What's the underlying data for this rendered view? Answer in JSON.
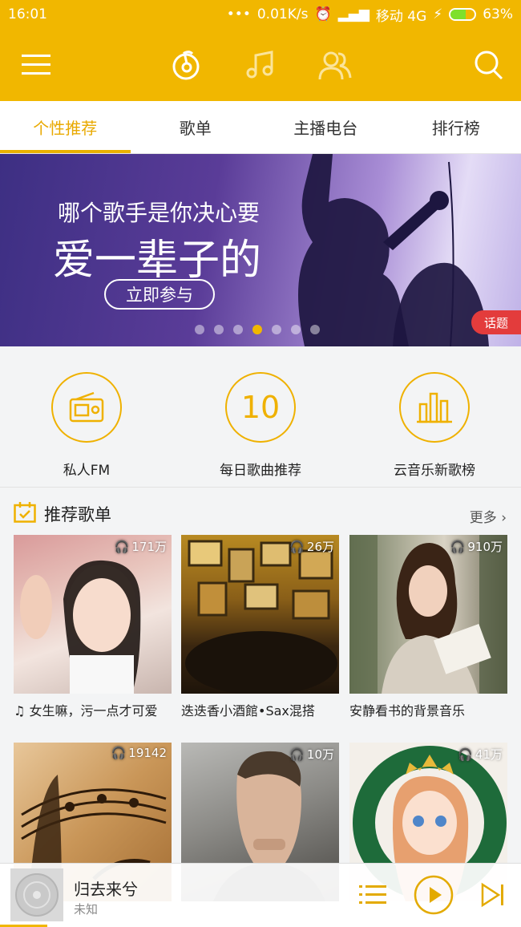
{
  "status_bar": {
    "time": "16:01",
    "speed": "0.01K/s",
    "carrier": "移动 4G",
    "battery": "63%",
    "battery_level": 0.63
  },
  "top_bar": {
    "icons": [
      "menu-icon",
      "netease-music-logo-icon",
      "music-note-icon",
      "friends-icon",
      "search-icon"
    ]
  },
  "tabs": [
    {
      "label": "个性推荐",
      "active": true
    },
    {
      "label": "歌单",
      "active": false
    },
    {
      "label": "主播电台",
      "active": false
    },
    {
      "label": "排行榜",
      "active": false
    }
  ],
  "banner": {
    "line1": "哪个歌手是你决心要",
    "line2": "爱一辈子的",
    "cta": "立即参与",
    "tag": "话题",
    "active_dot": 4,
    "dot_count": 7
  },
  "quick_entries": [
    {
      "label": "私人FM",
      "icon": "radio-icon"
    },
    {
      "label": "每日歌曲推荐",
      "icon": "calendar-day-icon",
      "number": "10"
    },
    {
      "label": "云音乐新歌榜",
      "icon": "bar-chart-icon"
    }
  ],
  "section": {
    "title": "推荐歌单",
    "more": "更多"
  },
  "playlists": [
    {
      "count": "171万",
      "caption": "女生嘛，污一点才可爱",
      "note": "♫"
    },
    {
      "count": "26万",
      "caption": "迭迭香小酒館•Sax混搭"
    },
    {
      "count": "910万",
      "caption": "安静看书的背景音乐"
    },
    {
      "count": "19142",
      "caption": ""
    },
    {
      "count": "10万",
      "caption": ""
    },
    {
      "count": "41万",
      "caption": ""
    }
  ],
  "player": {
    "song": "归去来兮",
    "artist": "未知",
    "progress": 0.09
  },
  "colors": {
    "brand": "#f1b700",
    "tag_red": "#e33c3c"
  }
}
